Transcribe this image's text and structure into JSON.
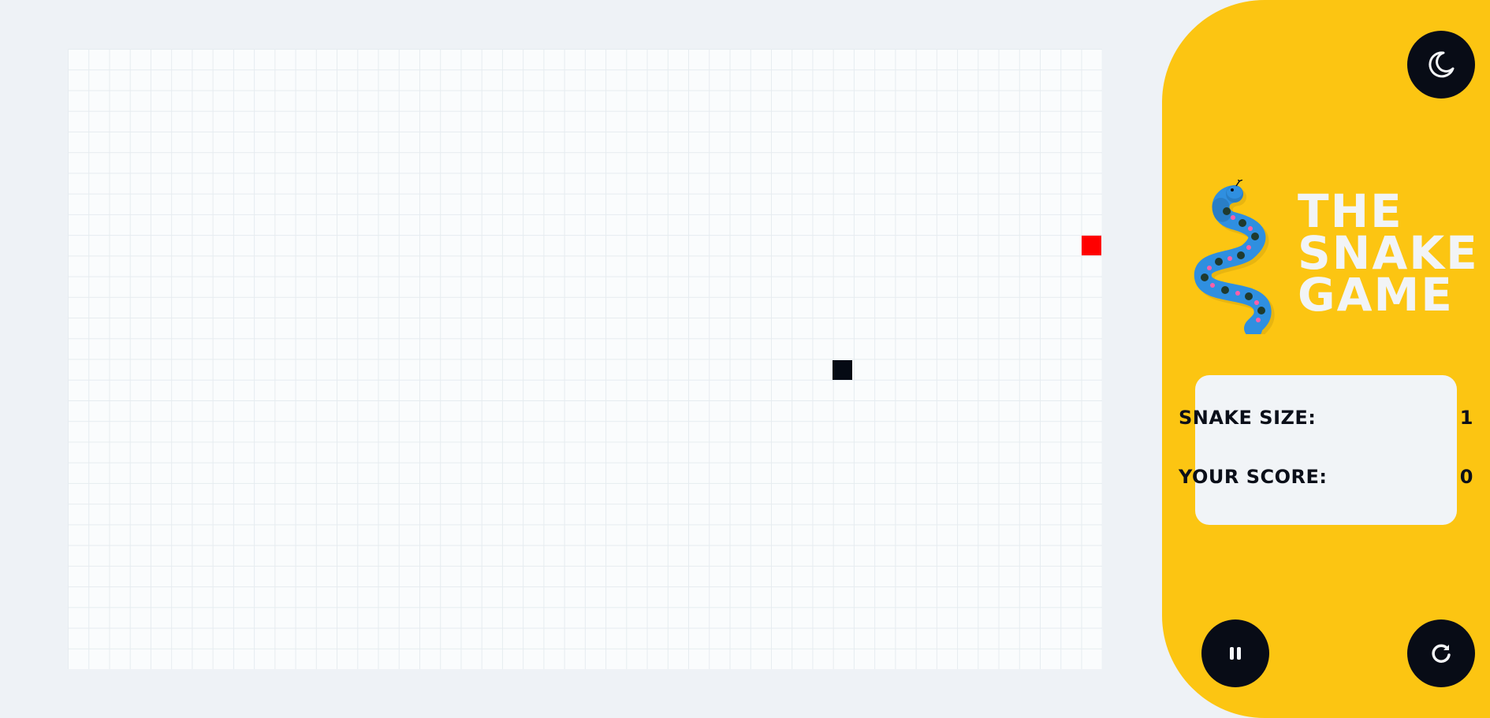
{
  "game": {
    "title_lines": [
      "THE",
      "SNAKE",
      "GAME"
    ],
    "food_color": "#ff0000",
    "snake_color": "#050a14"
  },
  "stats": {
    "snake_size_label": "SNAKE SIZE:",
    "snake_size_value": "1",
    "score_label": "YOUR SCORE:",
    "score_value": "0"
  },
  "controls": {
    "theme_icon": "moon-icon",
    "pause_icon": "pause-icon",
    "restart_icon": "restart-icon"
  },
  "colors": {
    "accent": "#fcc512",
    "button": "#080c16",
    "background": "#eef2f6"
  }
}
